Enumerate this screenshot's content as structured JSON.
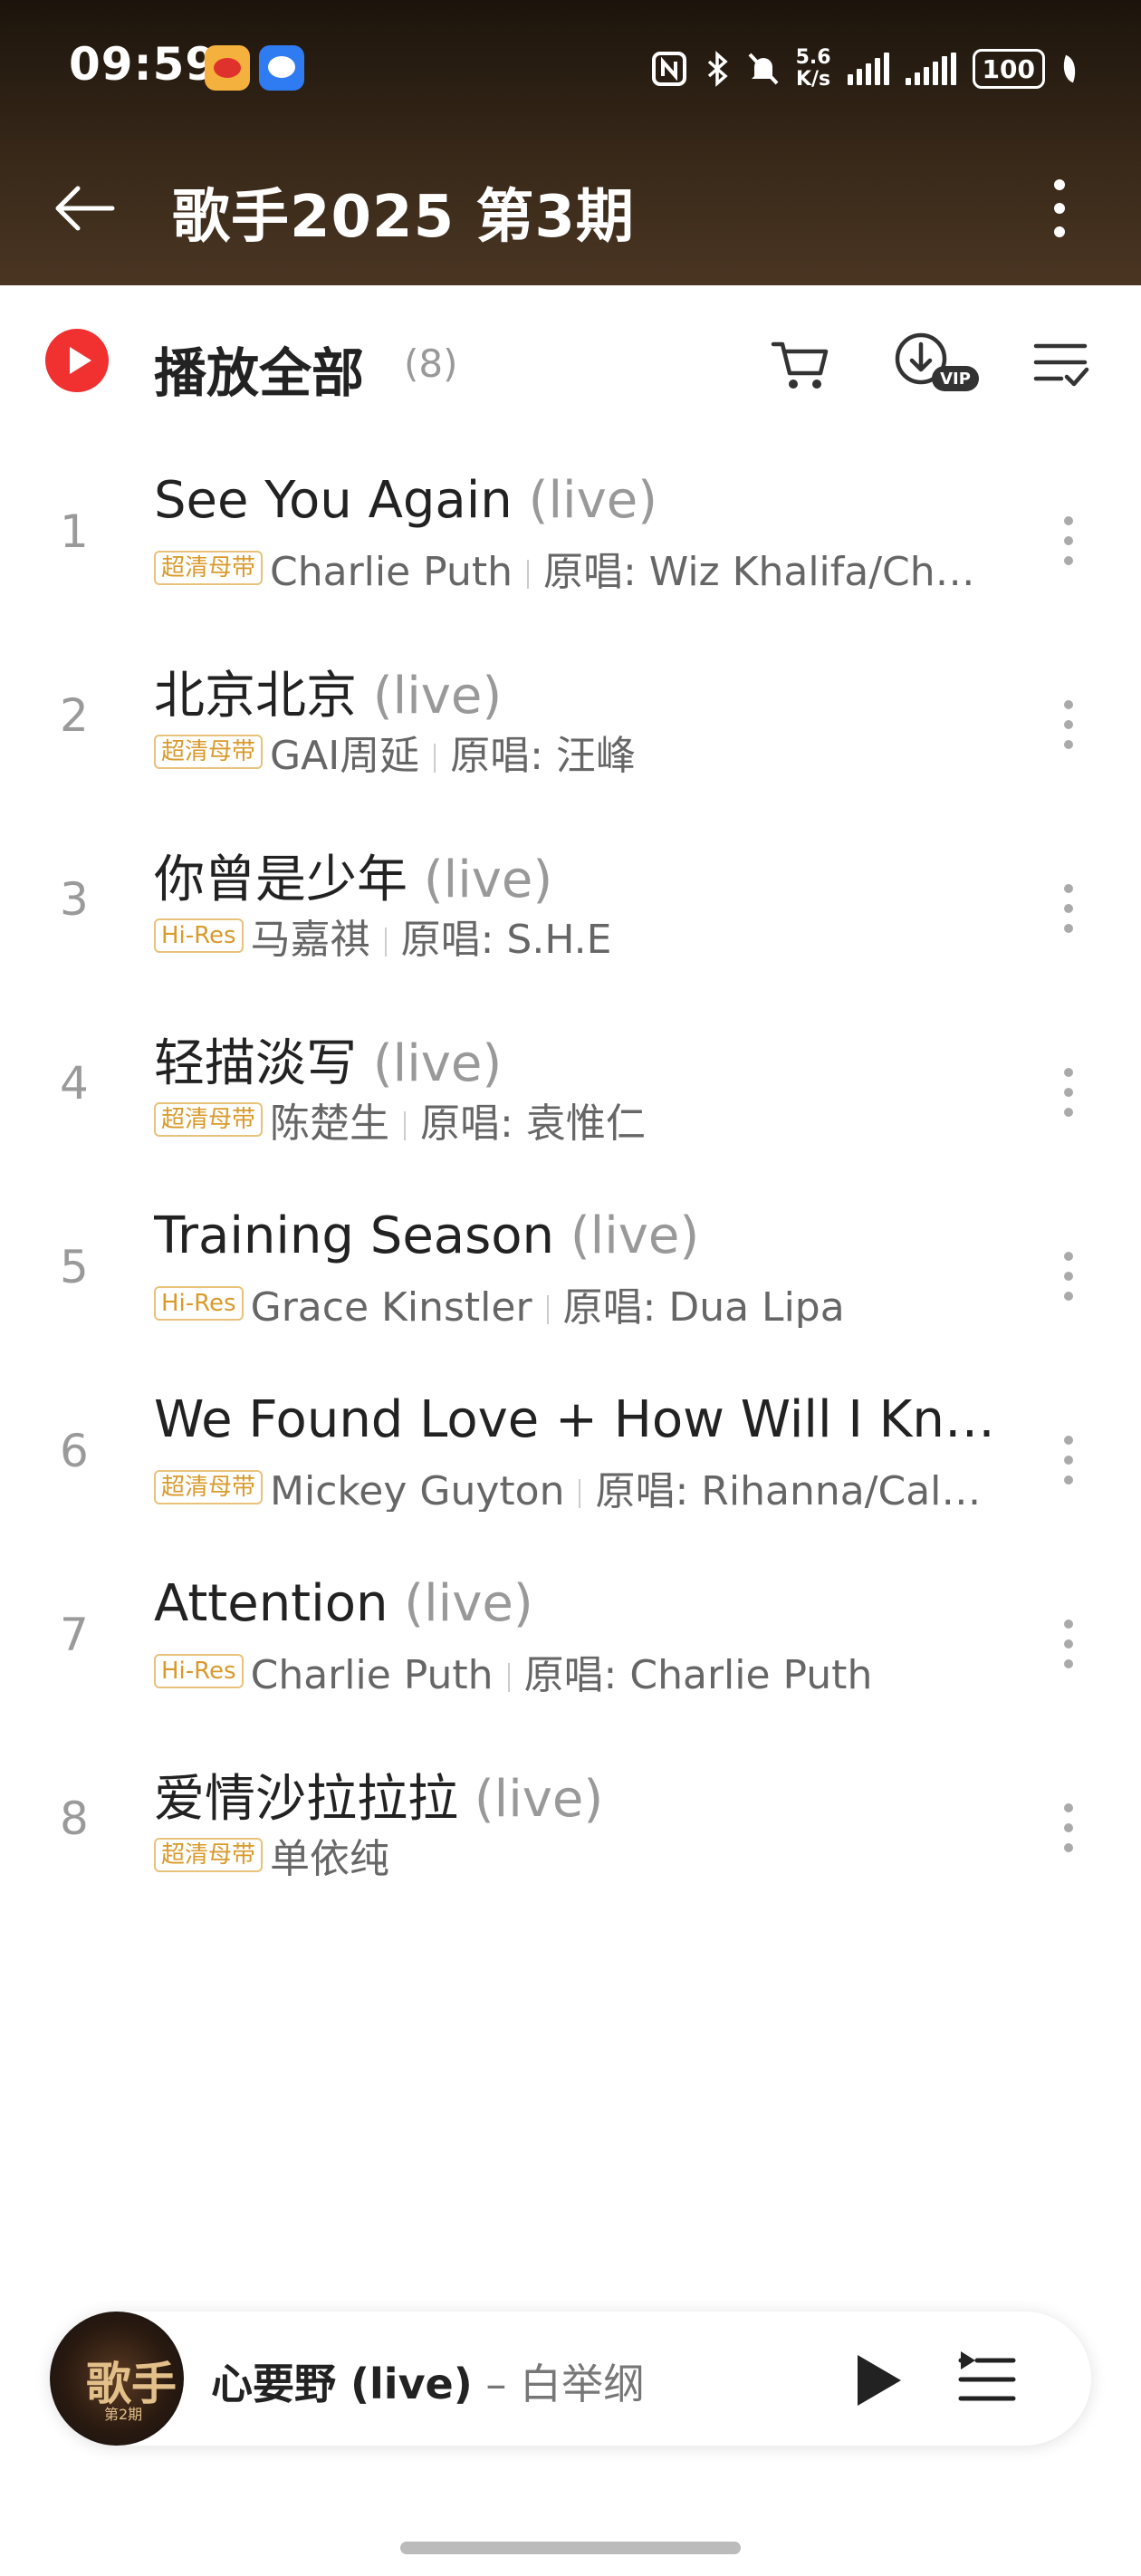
{
  "status_bar": {
    "time": "09:59",
    "net_speed_top": "5.6",
    "net_speed_bottom": "K/s",
    "battery": "100",
    "icons": [
      "weibo-icon",
      "message-icon",
      "nfc-icon",
      "bluetooth-icon",
      "mute-icon",
      "signal-icon",
      "signal-2-icon",
      "battery-icon",
      "leaf-icon"
    ]
  },
  "header": {
    "title": "歌手2025 第3期"
  },
  "play_all": {
    "label": "播放全部",
    "count": "(8)"
  },
  "colors": {
    "accent_red": "#f0312f",
    "badge_gold": "#d99a2b",
    "header_bg": "#2a1d12"
  },
  "songs": [
    {
      "num": "1",
      "title": "See You Again",
      "suffix": "(live)",
      "badge": "超清母带",
      "artist": "Charlie Puth",
      "original": "原唱: Wiz Khalifa/Ch…"
    },
    {
      "num": "2",
      "title": "北京北京",
      "suffix": "(live)",
      "badge": "超清母带",
      "artist": "GAI周延",
      "original": "原唱: 汪峰"
    },
    {
      "num": "3",
      "title": "你曾是少年",
      "suffix": "(live)",
      "badge": "Hi-Res",
      "artist": "马嘉祺",
      "original": "原唱: S.H.E"
    },
    {
      "num": "4",
      "title": "轻描淡写",
      "suffix": "(live)",
      "badge": "超清母带",
      "artist": "陈楚生",
      "original": "原唱: 袁惟仁"
    },
    {
      "num": "5",
      "title": "Training Season",
      "suffix": "(live)",
      "badge": "Hi-Res",
      "artist": "Grace Kinstler",
      "original": "原唱: Dua Lipa"
    },
    {
      "num": "6",
      "title": "We Found Love + How Will I Kno…",
      "suffix": "",
      "badge": "超清母带",
      "artist": "Mickey Guyton",
      "original": "原唱: Rihanna/Cal…"
    },
    {
      "num": "7",
      "title": "Attention",
      "suffix": "(live)",
      "badge": "Hi-Res",
      "artist": "Charlie Puth",
      "original": "原唱: Charlie Puth"
    },
    {
      "num": "8",
      "title": "爱情沙拉拉拉",
      "suffix": "(live)",
      "badge": "超清母带",
      "artist": "单依纯",
      "original": ""
    }
  ],
  "now_playing": {
    "title": "心要野 (live)",
    "artist": " – 白举纲",
    "cover_text": "歌手",
    "cover_sub": "第2期"
  }
}
